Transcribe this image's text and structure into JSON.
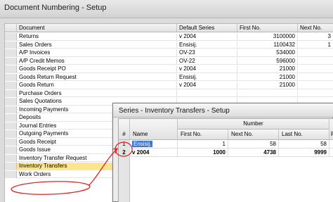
{
  "window": {
    "title": "Document Numbering - Setup"
  },
  "main_table": {
    "headers": [
      "",
      "Document",
      "Default Series",
      "First No.",
      "Next No."
    ],
    "rows": [
      {
        "num": "",
        "document": "Returns",
        "series": "v 2004",
        "first": "3100000",
        "next": "3"
      },
      {
        "num": "",
        "document": "Sales Orders",
        "series": "Ensisij.",
        "first": "1100432",
        "next": "1"
      },
      {
        "num": "",
        "document": "A/P Invoices",
        "series": "OV-23",
        "first": "534000",
        "next": ""
      },
      {
        "num": "",
        "document": "A/P Credit Memos",
        "series": "OV-22",
        "first": "596000",
        "next": ""
      },
      {
        "num": "",
        "document": "Goods Receipt PO",
        "series": "v 2004",
        "first": "21000",
        "next": ""
      },
      {
        "num": "",
        "document": "Goods Return Request",
        "series": "Ensisij.",
        "first": "21000",
        "next": ""
      },
      {
        "num": "",
        "document": "Goods Return",
        "series": "v 2004",
        "first": "21000",
        "next": ""
      },
      {
        "num": "",
        "document": "Purchase Orders",
        "series": "",
        "first": "",
        "next": ""
      },
      {
        "num": "",
        "document": "Sales Quotations",
        "series": "",
        "first": "",
        "next": ""
      },
      {
        "num": "",
        "document": "Incoming Payments",
        "series": "",
        "first": "",
        "next": ""
      },
      {
        "num": "",
        "document": "Deposits",
        "series": "",
        "first": "",
        "next": ""
      },
      {
        "num": "",
        "document": "Journal Entries",
        "series": "",
        "first": "",
        "next": ""
      },
      {
        "num": "",
        "document": "Outgoing Payments",
        "series": "",
        "first": "",
        "next": ""
      },
      {
        "num": "",
        "document": "Goods Receipt",
        "series": "",
        "first": "",
        "next": ""
      },
      {
        "num": "",
        "document": "Goods Issue",
        "series": "",
        "first": "",
        "next": ""
      },
      {
        "num": "",
        "document": "Inventory Transfer Request",
        "series": "",
        "first": "",
        "next": ""
      },
      {
        "num": "",
        "document": "Inventory Transfers",
        "series": "",
        "first": "",
        "next": ""
      },
      {
        "num": "",
        "document": "Work Orders",
        "series": "",
        "first": "",
        "next": ""
      }
    ],
    "selected_index": 16
  },
  "dialog": {
    "title": "Series - Inventory Transfers - Setup",
    "group_header": "Number",
    "headers": [
      "#",
      "Name",
      "First No.",
      "Next No.",
      "Last No.",
      "Pr"
    ],
    "rows": [
      {
        "num": "1",
        "name": "Ensisij.",
        "first": "1",
        "next": "58",
        "last": "58"
      },
      {
        "num": "2",
        "name": "v 2004",
        "first": "1000",
        "next": "4738",
        "last": "9999"
      }
    ]
  },
  "annotation": {
    "color": "#e32222"
  }
}
